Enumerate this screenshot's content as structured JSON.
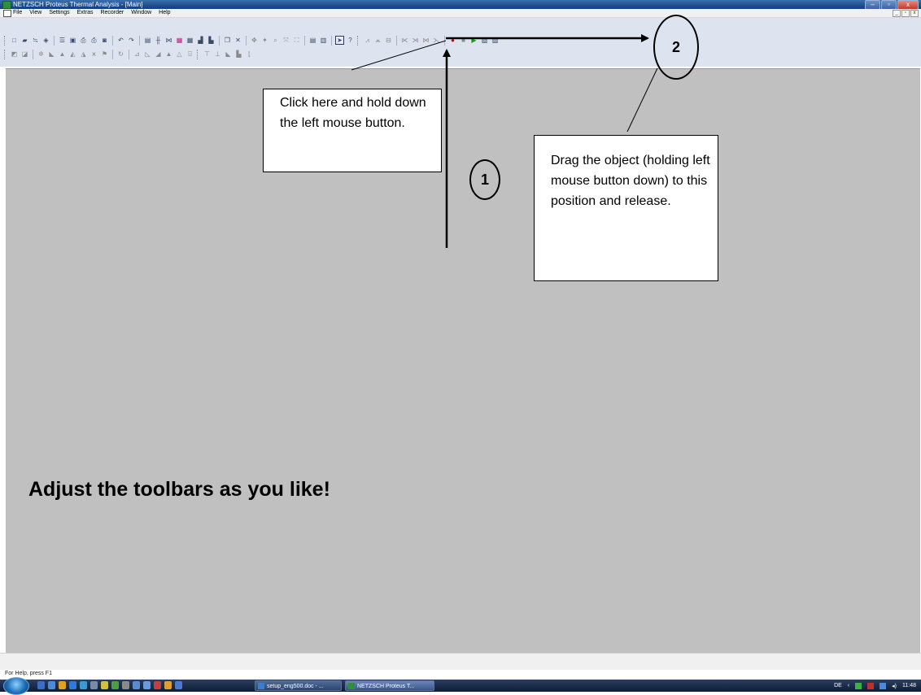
{
  "window": {
    "title": "NETZSCH Proteus Thermal Analysis - [Main]",
    "controls": {
      "minimize": "–",
      "maximize": "▫",
      "close": "x"
    }
  },
  "menubar": {
    "items": [
      "File",
      "View",
      "Settings",
      "Extras",
      "Recorder",
      "Window",
      "Help"
    ],
    "mdi_controls": {
      "minimize": "_",
      "restore": "▫",
      "close": "x"
    }
  },
  "toolbars": {
    "row1_icons": [
      "new-icon",
      "open-icon",
      "properties-icon",
      "tag-icon",
      "list-icon",
      "preview-icon",
      "print-icon",
      "print2-icon",
      "export-icon",
      "undo-icon",
      "redo-icon",
      "chart-icon",
      "axis-icon",
      "curve-icon",
      "table-icon",
      "grid-icon",
      "bars-icon",
      "plot-icon",
      "window-icon",
      "delete-icon",
      "zoom-in-icon",
      "zoom-out-icon",
      "zoom-icon",
      "fit-icon",
      "expand-icon",
      "copy-icon",
      "paste-icon",
      "pointer-icon",
      "help-pointer-icon",
      "peak-icon",
      "peaks-icon",
      "baseline-icon",
      "onset-icon",
      "step-icon",
      "area-icon",
      "range-icon",
      "record-icon",
      "stop-icon",
      "play-icon",
      "report-icon",
      "setup-icon"
    ],
    "row2_icons": [
      "curve-a-icon",
      "curve-b-icon",
      "gear-icon",
      "slope-icon",
      "peak-area-icon",
      "peak-left-icon",
      "peak-right-icon",
      "shape-icon",
      "flag-icon",
      "refresh-icon",
      "deriv-icon",
      "step-curve-icon",
      "ramp-icon",
      "triangle-icon",
      "triangle2-icon",
      "calc-icon",
      "tangent-icon",
      "tangent2-icon",
      "level-icon",
      "level2-icon",
      "mark-icon"
    ]
  },
  "annotations": {
    "note_click": "Click here and hold down the left mouse button.",
    "note_drag": "Drag the object (holding left mouse button down) to this position and release.",
    "badge_1": "1",
    "badge_2": "2",
    "headline": "Adjust the toolbars as you like!"
  },
  "status": {
    "text": "For Help, press F1"
  },
  "taskbar": {
    "buttons": [
      {
        "label": "setup_eng500.doc - ..."
      },
      {
        "label": "NETZSCH Proteus T..."
      }
    ],
    "tray": {
      "lang": "DE",
      "time": "11:48"
    }
  },
  "colors": {
    "workspace": "#c0c0c0",
    "toolbar_bg": "#dde4f0",
    "titlebar": "#1f4f8f",
    "record": "#d00000",
    "play": "#12a012"
  }
}
